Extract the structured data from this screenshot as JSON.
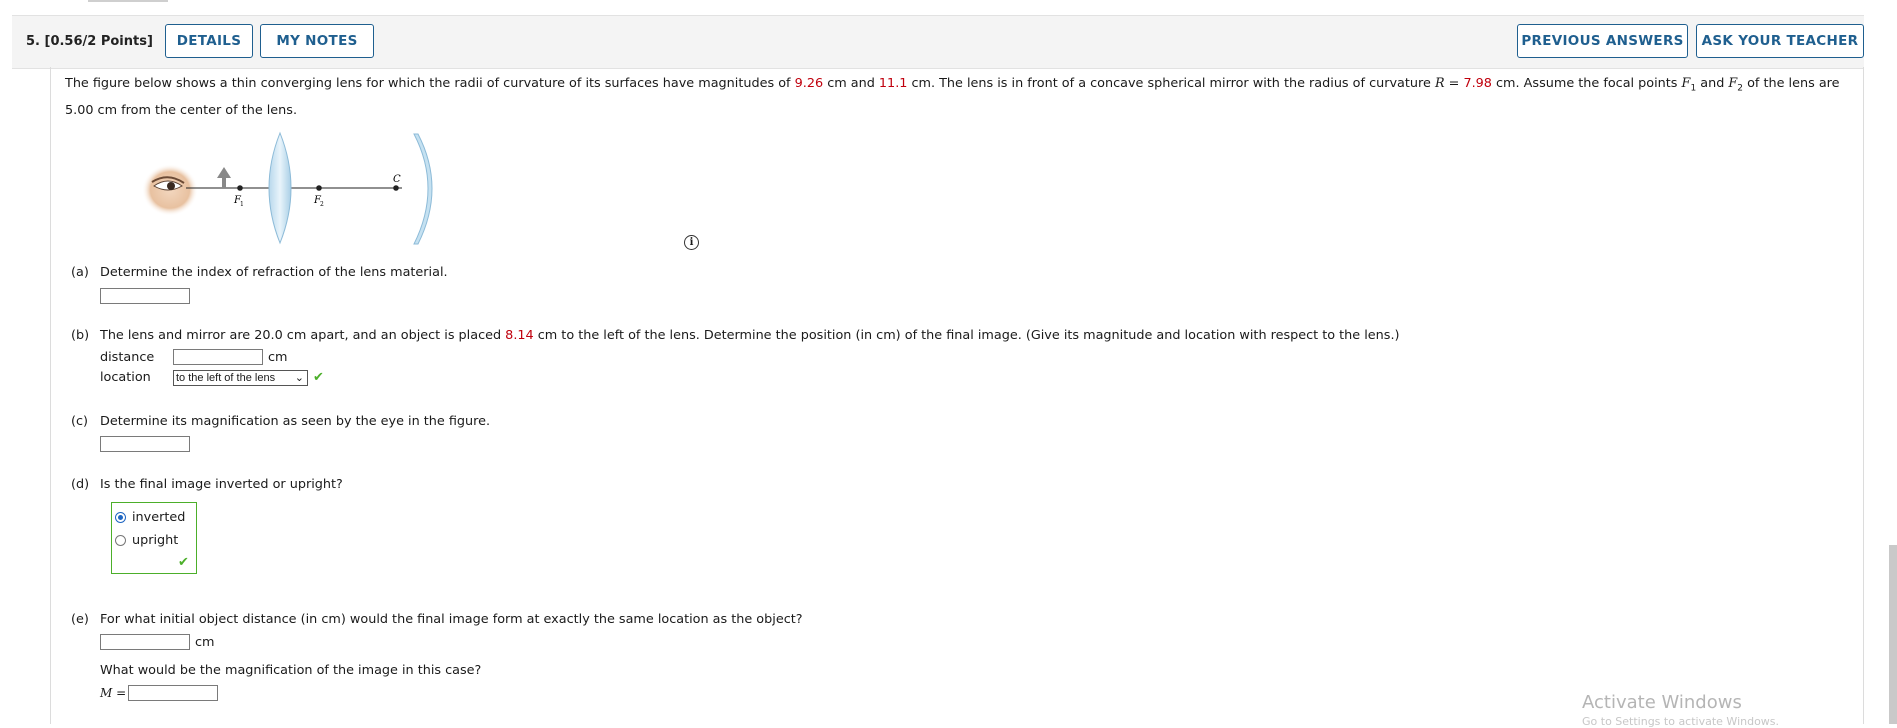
{
  "question": {
    "number_points": "5.  [0.56/2 Points]"
  },
  "buttons": {
    "details": "DETAILS",
    "my_notes": "MY NOTES",
    "previous_answers": "PREVIOUS ANSWERS",
    "ask_teacher": "ASK YOUR TEACHER"
  },
  "intro": {
    "t1": "The figure below shows a thin converging lens for which the radii of curvature of its surfaces have magnitudes of ",
    "r1": "9.26",
    "t2": " cm and ",
    "r2": "11.1",
    "t3": " cm. The lens is in front of a concave spherical mirror with the radius of curvature ",
    "R_sym": "R",
    "t4": " = ",
    "R_val": "7.98",
    "t5": " cm. Assume the focal points ",
    "F": "F",
    "sub1": "1",
    "t6": " and ",
    "sub2": "2",
    "t7": " of the lens are 5.00 cm from the center of the lens."
  },
  "figure": {
    "label_f1": "F",
    "label_f1_sub": "1",
    "label_f2": "F",
    "label_f2_sub": "2",
    "label_c": "C"
  },
  "info_icon": "i",
  "parts": {
    "a": {
      "label": "(a)",
      "text": "Determine the index of refraction of the lens material."
    },
    "b": {
      "label": "(b)",
      "t1": "The lens and mirror are 20.0 cm apart, and an object is placed ",
      "val": "8.14",
      "t2": " cm to the left of the lens. Determine the position (in cm) of the final image. (Give its magnitude and location with respect to the lens.)",
      "distance_label": "distance",
      "unit": "cm",
      "location_label": "location",
      "location_value": "to the left of the lens"
    },
    "c": {
      "label": "(c)",
      "text": "Determine its magnification as seen by the eye in the figure."
    },
    "d": {
      "label": "(d)",
      "text": "Is the final image inverted or upright?",
      "options": [
        "inverted",
        "upright"
      ],
      "selected": "inverted"
    },
    "e": {
      "label": "(e)",
      "text": "For what initial object distance (in cm) would the final image form at exactly the same location as the object?",
      "unit": "cm",
      "text2": "What would be the magnification of the image in this case?",
      "m_label": "M ="
    }
  },
  "check_mark": "✔",
  "watermark": "Activate Windows",
  "watermark2": "Go to Settings to activate Windows."
}
